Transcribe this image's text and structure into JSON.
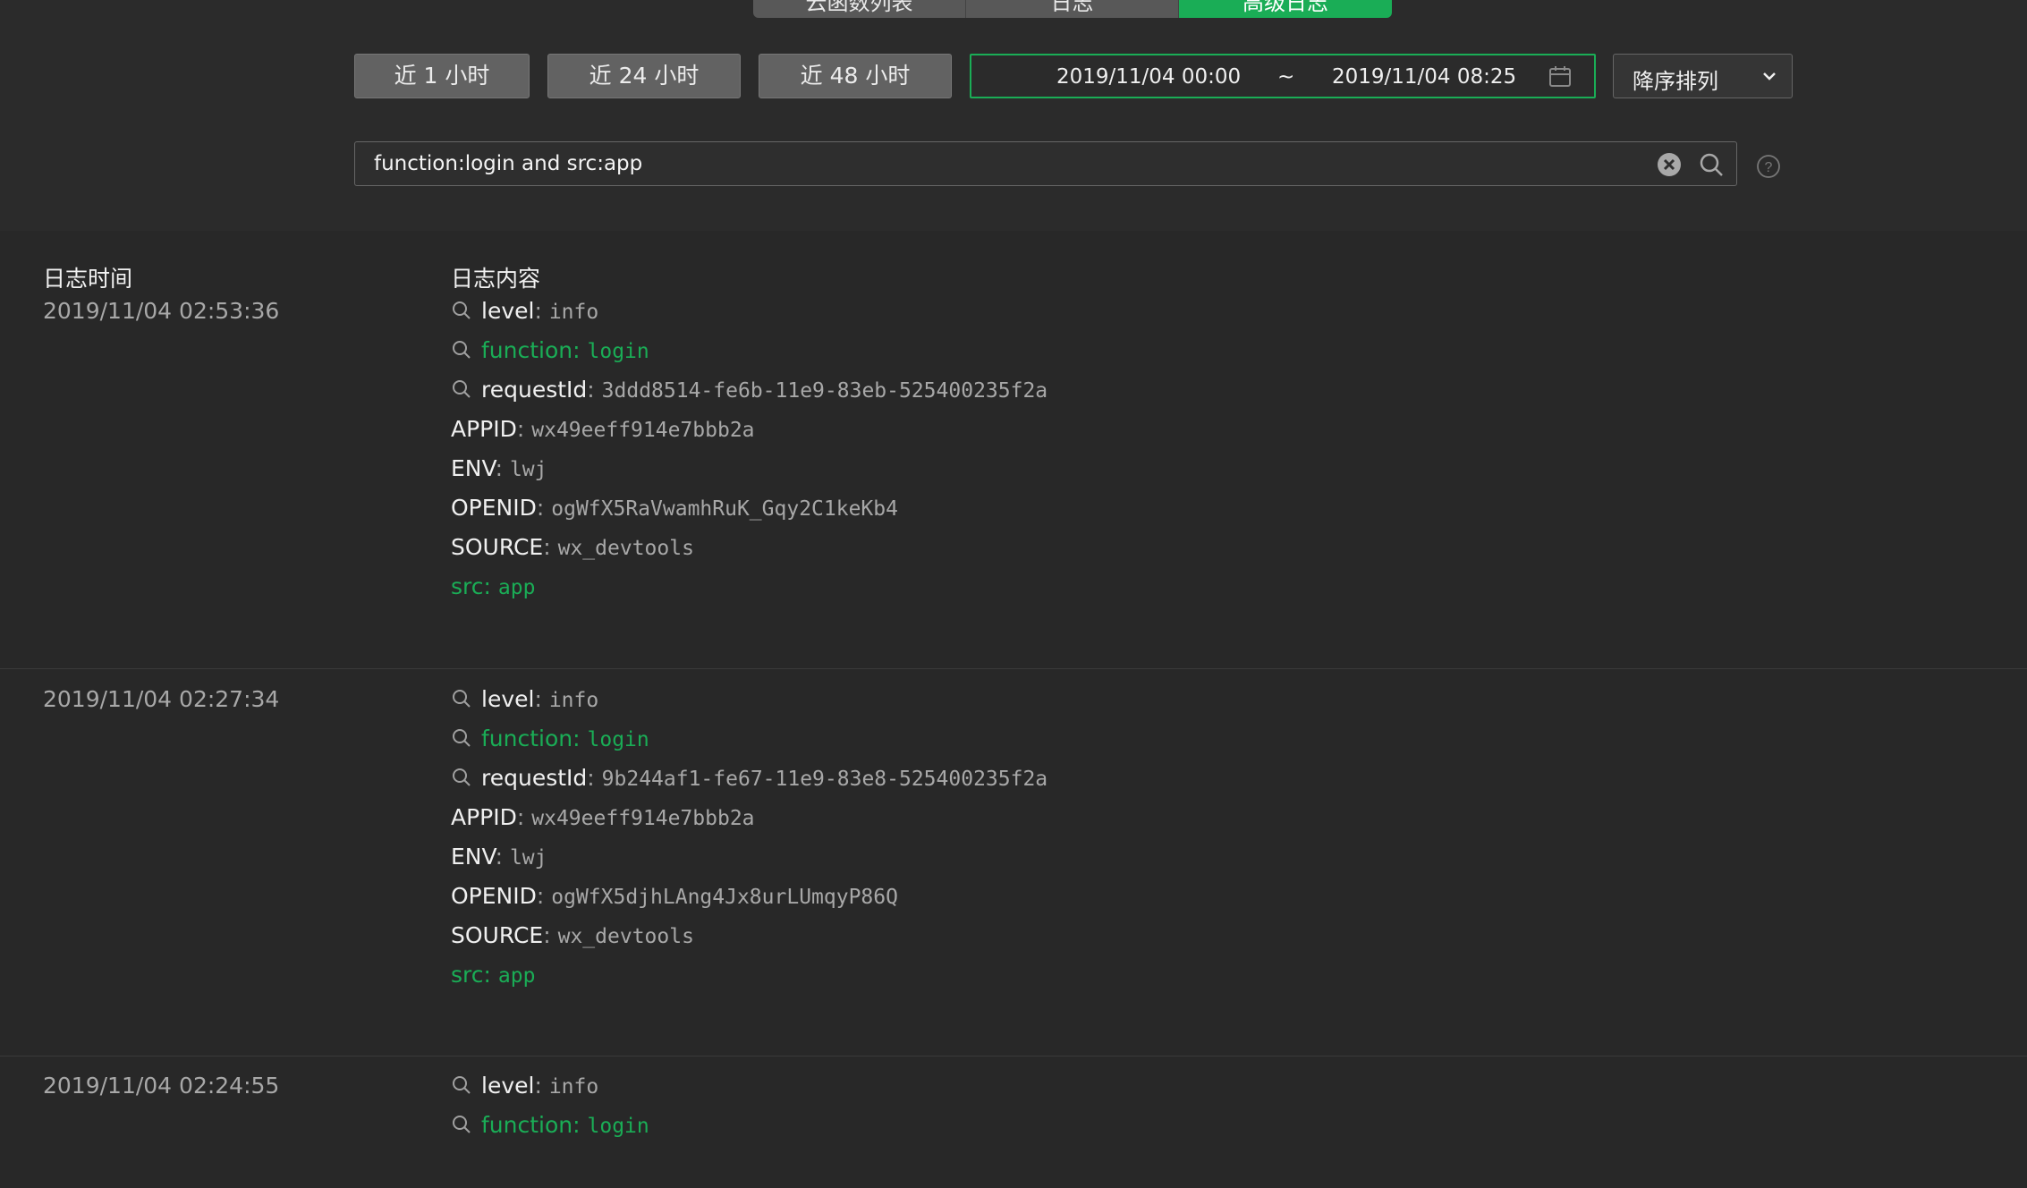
{
  "tabs": [
    {
      "label": "云函数列表"
    },
    {
      "label": "日志"
    },
    {
      "label": "高级日志"
    }
  ],
  "time_range_buttons": [
    {
      "label": "近 1 小时"
    },
    {
      "label": "近 24 小时"
    },
    {
      "label": "近 48 小时"
    }
  ],
  "date_range": {
    "start": "2019/11/04 00:00",
    "separator": "~",
    "end": "2019/11/04 08:25"
  },
  "sort": {
    "selected": "降序排列"
  },
  "search": {
    "value": "function:login and src:app"
  },
  "table": {
    "headers": {
      "time": "日志时间",
      "content": "日志内容"
    },
    "entries": [
      {
        "time": "2019/11/04 02:53:36",
        "fields": [
          {
            "key": "level",
            "value": "info",
            "searchable": true,
            "highlight": false
          },
          {
            "key": "function",
            "value": "login",
            "searchable": true,
            "highlight": true
          },
          {
            "key": "requestId",
            "value": "3ddd8514-fe6b-11e9-83eb-525400235f2a",
            "searchable": true,
            "highlight": false
          },
          {
            "key": "APPID",
            "value": "wx49eeff914e7bbb2a",
            "searchable": false,
            "highlight": false
          },
          {
            "key": "ENV",
            "value": "lwj",
            "searchable": false,
            "highlight": false
          },
          {
            "key": "OPENID",
            "value": "ogWfX5RaVwamhRuK_Gqy2C1keKb4",
            "searchable": false,
            "highlight": false
          },
          {
            "key": "SOURCE",
            "value": "wx_devtools",
            "searchable": false,
            "highlight": false
          },
          {
            "key": "src",
            "value": "app",
            "searchable": false,
            "highlight": true
          }
        ]
      },
      {
        "time": "2019/11/04 02:27:34",
        "fields": [
          {
            "key": "level",
            "value": "info",
            "searchable": true,
            "highlight": false
          },
          {
            "key": "function",
            "value": "login",
            "searchable": true,
            "highlight": true
          },
          {
            "key": "requestId",
            "value": "9b244af1-fe67-11e9-83e8-525400235f2a",
            "searchable": true,
            "highlight": false
          },
          {
            "key": "APPID",
            "value": "wx49eeff914e7bbb2a",
            "searchable": false,
            "highlight": false
          },
          {
            "key": "ENV",
            "value": "lwj",
            "searchable": false,
            "highlight": false
          },
          {
            "key": "OPENID",
            "value": "ogWfX5djhLAng4Jx8urLUmqyP86Q",
            "searchable": false,
            "highlight": false
          },
          {
            "key": "SOURCE",
            "value": "wx_devtools",
            "searchable": false,
            "highlight": false
          },
          {
            "key": "src",
            "value": "app",
            "searchable": false,
            "highlight": true
          }
        ]
      },
      {
        "time": "2019/11/04 02:24:55",
        "fields": [
          {
            "key": "level",
            "value": "info",
            "searchable": true,
            "highlight": false
          },
          {
            "key": "function",
            "value": "login",
            "searchable": true,
            "highlight": true
          }
        ]
      }
    ]
  },
  "colors": {
    "accent": "#1aad56",
    "background": "#2b2b2b"
  },
  "icons": {
    "calendar": "calendar-icon",
    "chevron": "chevron-down-icon",
    "clear": "clear-icon",
    "search": "search-icon",
    "help": "help-icon",
    "field_search": "magnifier-icon"
  }
}
